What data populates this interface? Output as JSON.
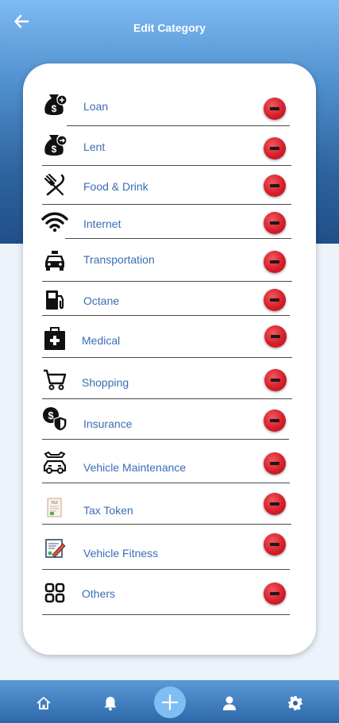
{
  "header": {
    "title": "Edit Category"
  },
  "categories": [
    {
      "label": "Loan",
      "icon": "money-bag-plus-icon"
    },
    {
      "label": "Lent",
      "icon": "money-bag-arrow-icon"
    },
    {
      "label": "Food & Drink",
      "icon": "fork-knife-icon"
    },
    {
      "label": "Internet",
      "icon": "wifi-icon"
    },
    {
      "label": "Transportation",
      "icon": "taxi-icon"
    },
    {
      "label": "Octane",
      "icon": "fuel-pump-icon"
    },
    {
      "label": "Medical",
      "icon": "first-aid-kit-icon"
    },
    {
      "label": "Shopping",
      "icon": "shopping-cart-icon"
    },
    {
      "label": "Insurance",
      "icon": "coin-shield-icon"
    },
    {
      "label": "Vehicle Maintenance",
      "icon": "car-wrench-icon"
    },
    {
      "label": "Tax Token",
      "icon": "tax-document-icon"
    },
    {
      "label": "Vehicle Fitness",
      "icon": "certificate-pen-icon"
    },
    {
      "label": "Others",
      "icon": "grid-icon"
    }
  ],
  "bottom_nav": {
    "items": [
      "home-icon",
      "bell-icon",
      "plus-icon",
      "user-icon",
      "gear-icon"
    ]
  },
  "colors": {
    "accent": "#3a6db5",
    "remove": "#d81e2b",
    "nav": "#2d67a8"
  }
}
